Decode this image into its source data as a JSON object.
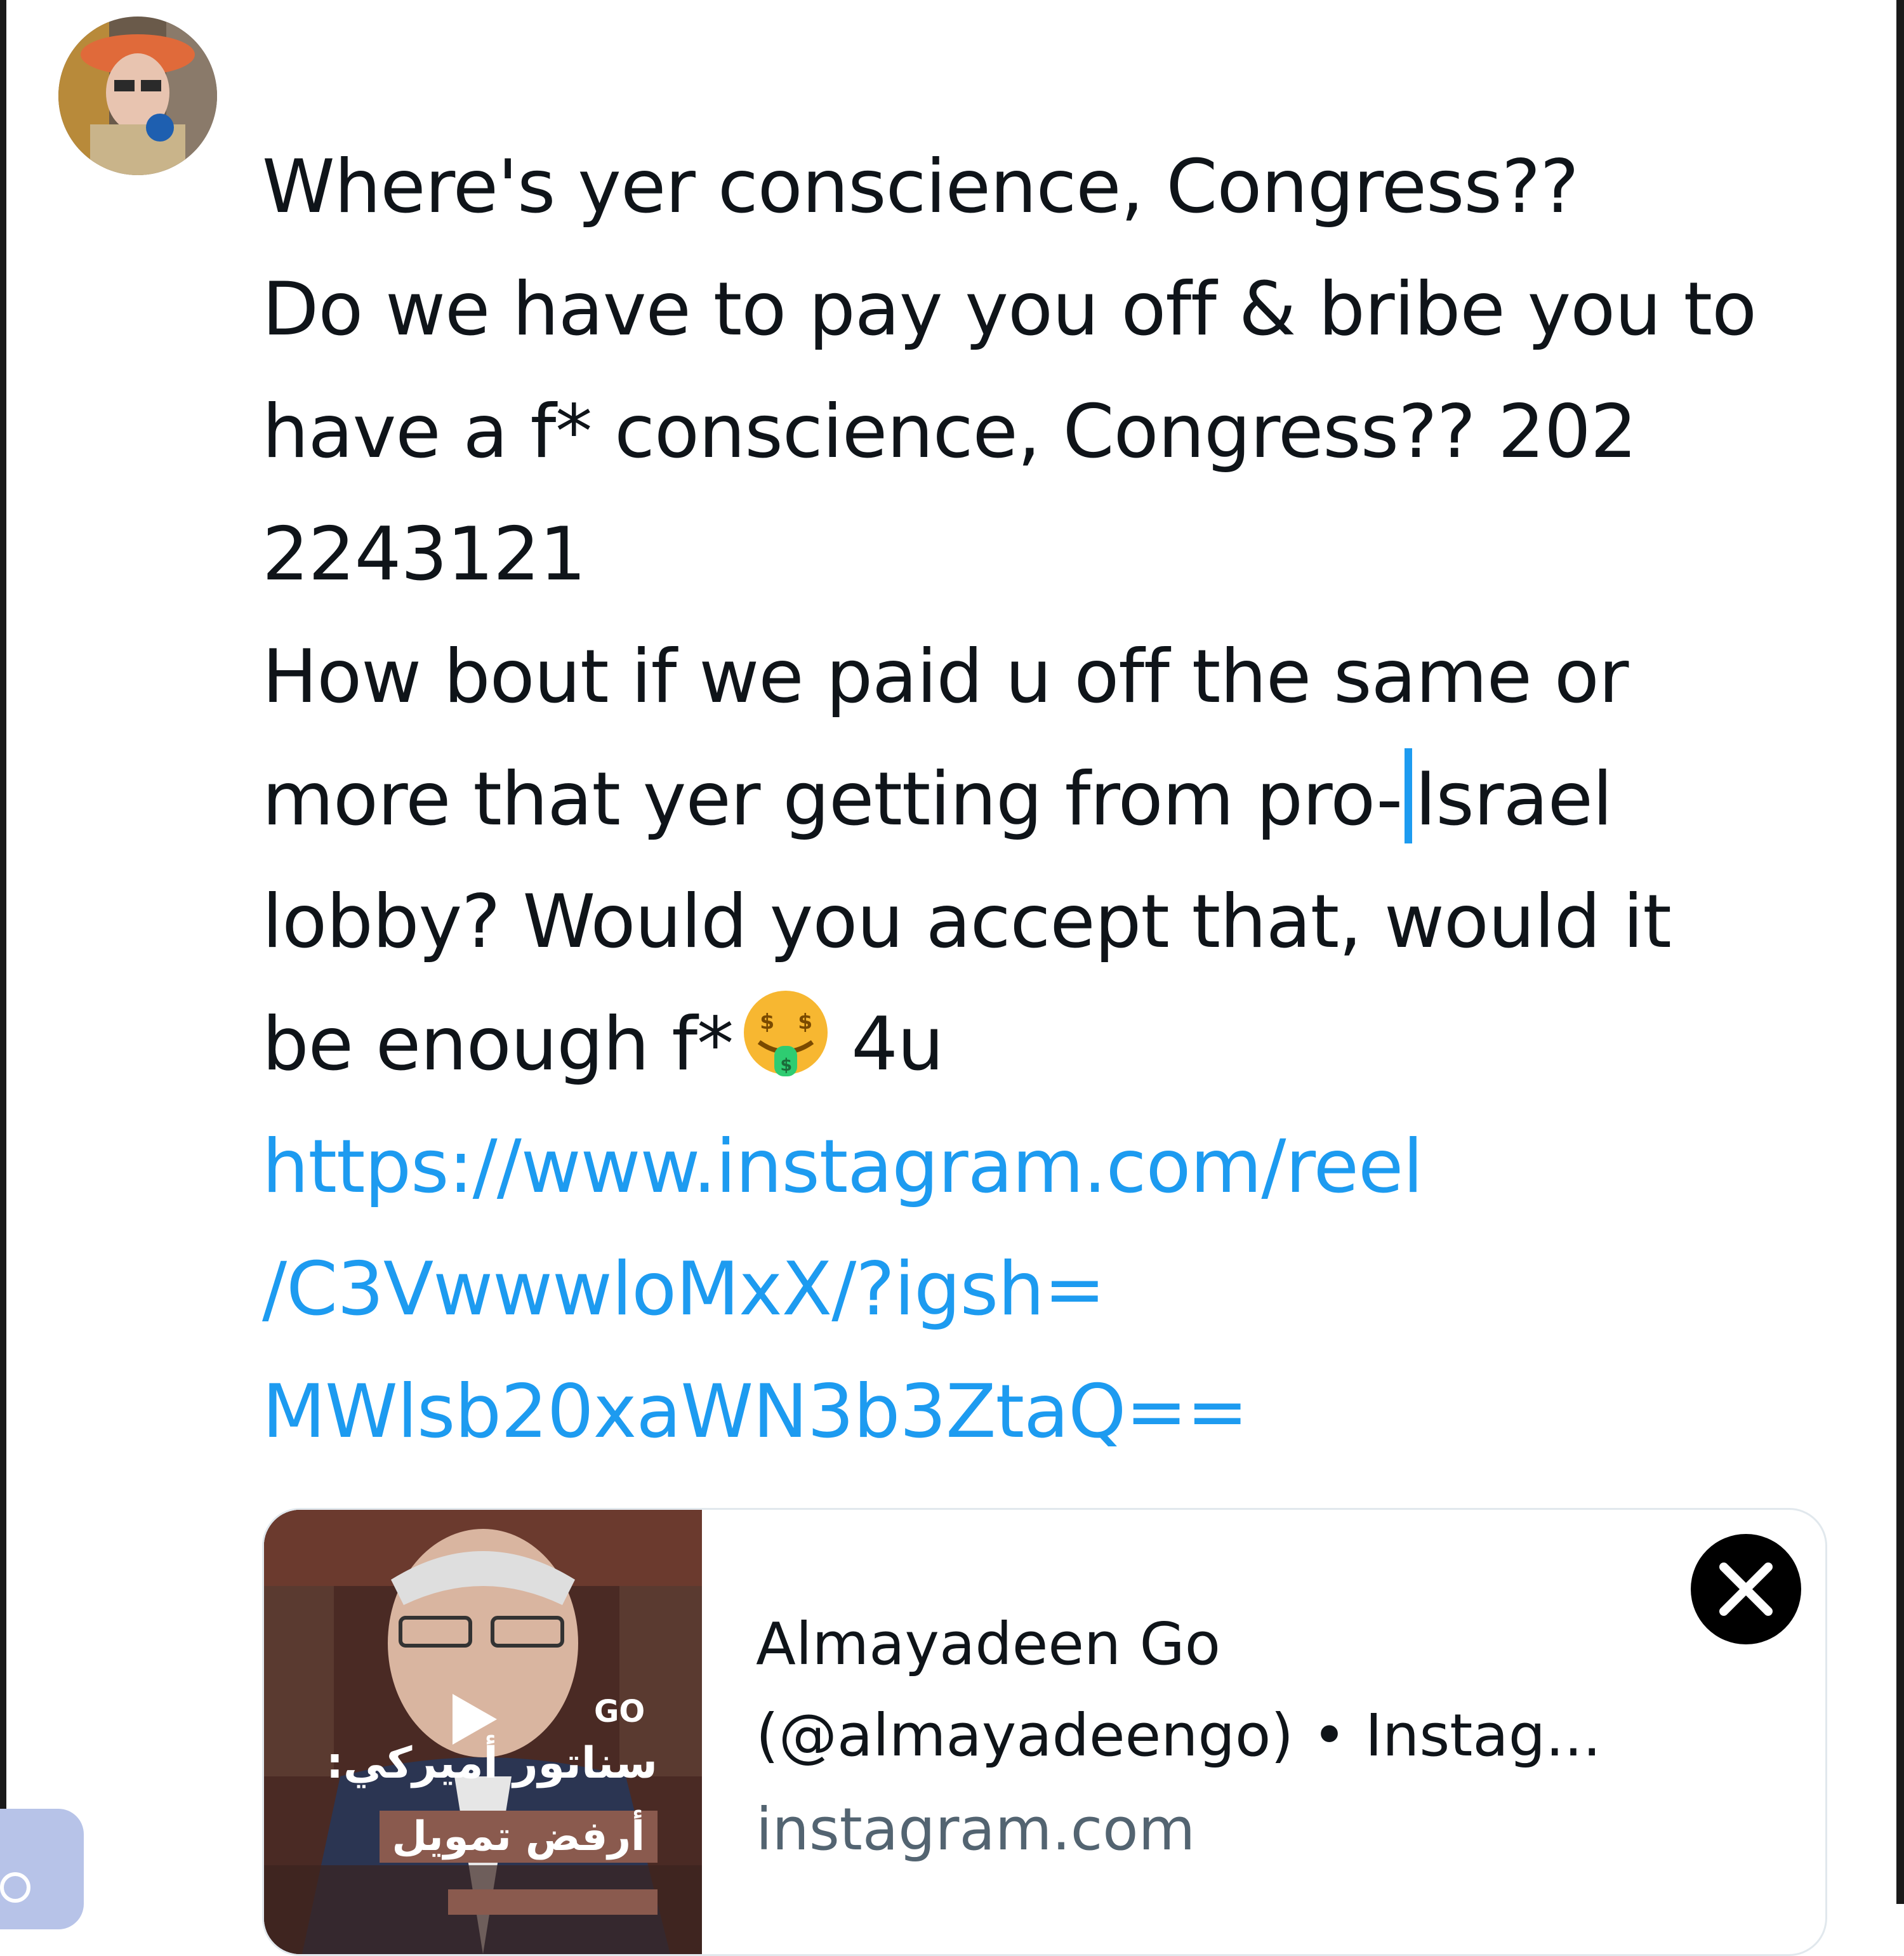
{
  "post": {
    "avatar_alt": "profile-avatar",
    "text_before_caret": "Where's yer conscience, Congress??\nDo we have to pay you off & bribe you to\nhave a f* conscience, Congress?? 202\n2243121\nHow bout if we paid u off the same or\nmore that yer getting from pro-",
    "text_after_caret": "Israel\nlobby? Would you accept that, would it\nbe enough f*",
    "text_after_emoji": "4u",
    "emoji_name": "money-mouth-face-icon",
    "link_text": "https://www.instagram.com/reel\n/C3VwwwloMxX/?igsh=\nMWlsb20xaWN3b3ZtaQ=="
  },
  "link_card": {
    "title": "Almayadeen Go\n(@almayadeengo) • Instag...",
    "domain": "instagram.com",
    "thumbnail": {
      "badge": "GO",
      "line1": "سناتور أميركي:",
      "line2": "أرفض تمويل"
    }
  },
  "colors": {
    "link": "#1d9bf0",
    "text": "#0f1419",
    "secondary": "#536471",
    "card_border": "#e1e8ed"
  }
}
